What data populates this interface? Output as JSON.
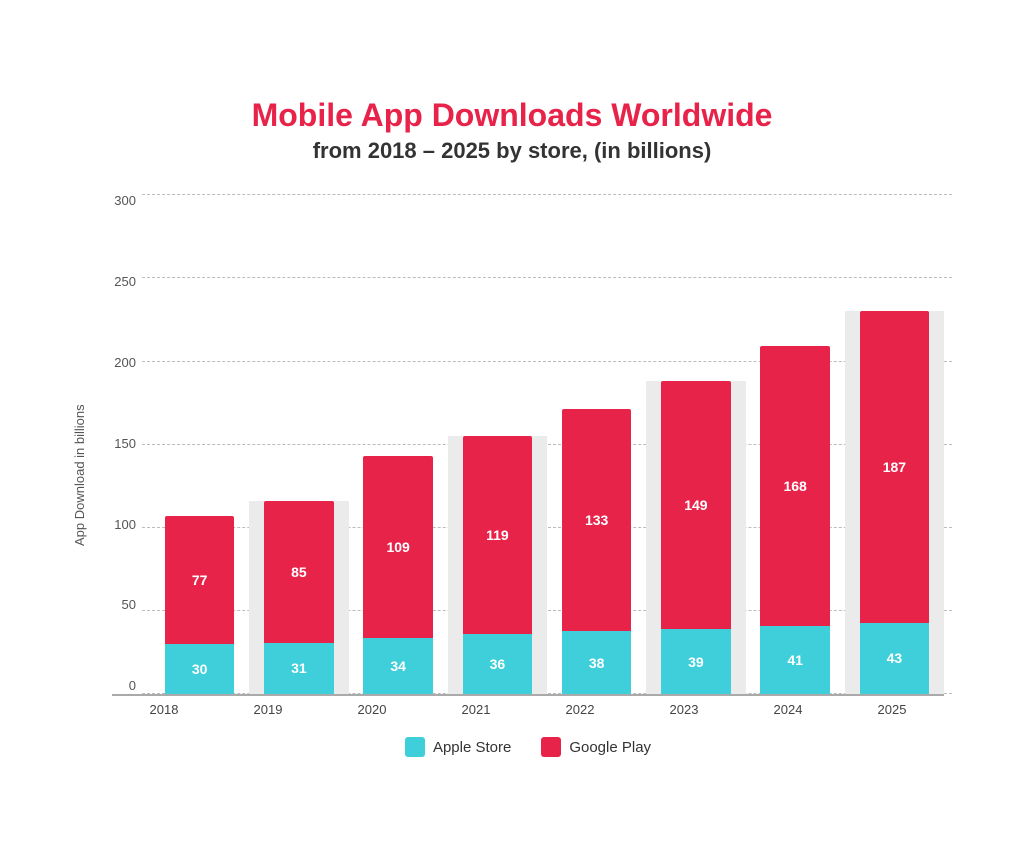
{
  "title": "Mobile App Downloads Worldwide",
  "subtitle": "from 2018 – 2025 by store, (in billions)",
  "yAxisLabel": "App Download in billions",
  "yTicks": [
    0,
    50,
    100,
    150,
    200,
    250,
    300
  ],
  "maxValue": 300,
  "bars": [
    {
      "year": "2018",
      "apple": 30,
      "google": 77,
      "shaded": false
    },
    {
      "year": "2019",
      "apple": 31,
      "google": 85,
      "shaded": true
    },
    {
      "year": "2020",
      "apple": 34,
      "google": 109,
      "shaded": false
    },
    {
      "year": "2021",
      "apple": 36,
      "google": 119,
      "shaded": true
    },
    {
      "year": "2022",
      "apple": 38,
      "google": 133,
      "shaded": false
    },
    {
      "year": "2023",
      "apple": 39,
      "google": 149,
      "shaded": true
    },
    {
      "year": "2024",
      "apple": 41,
      "google": 168,
      "shaded": false
    },
    {
      "year": "2025",
      "apple": 43,
      "google": 187,
      "shaded": true
    }
  ],
  "legend": {
    "apple": {
      "label": "Apple Store",
      "color": "#3ecfda"
    },
    "google": {
      "label": "Google Play",
      "color": "#e8234a"
    }
  },
  "colors": {
    "title": "#e8234a",
    "subtitle": "#333333",
    "apple": "#3ecfda",
    "google": "#e8234a"
  }
}
